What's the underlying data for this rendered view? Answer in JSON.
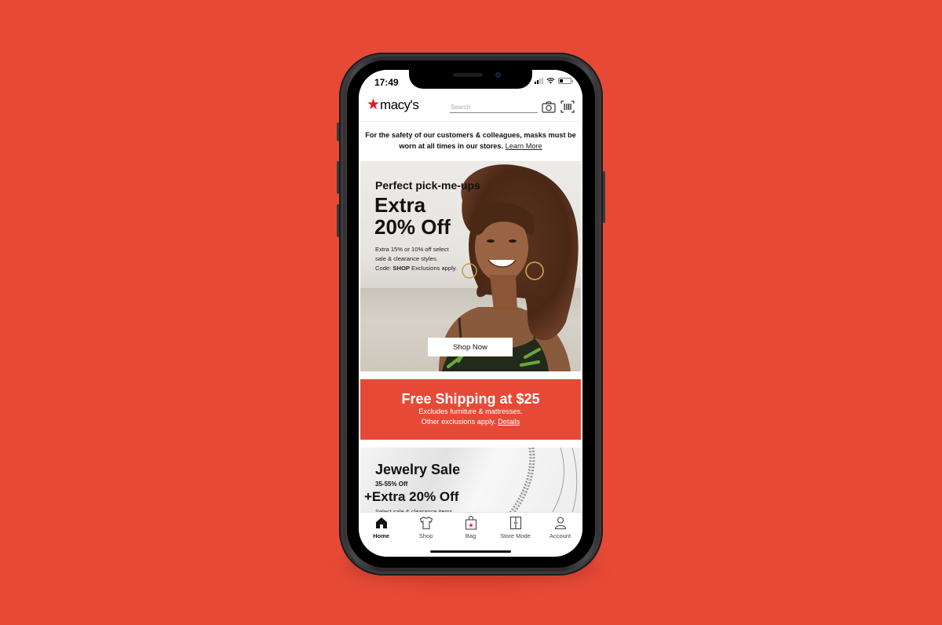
{
  "colors": {
    "background": "#e64a37",
    "brand_red": "#e11b22",
    "promo_banner": "#e64a37"
  },
  "status_bar": {
    "time": "17:49",
    "icons": [
      "signal-icon",
      "wifi-icon",
      "battery-icon"
    ]
  },
  "header": {
    "logo_text": "macy's",
    "search_placeholder": "Search",
    "icons": [
      "search-icon",
      "camera-icon",
      "barcode-scanner-icon"
    ]
  },
  "notice": {
    "text": "For the safety of our customers & colleagues, masks must be worn at all times in our stores.",
    "link": "Learn More"
  },
  "hero": {
    "kicker": "Perfect pick-me-ups",
    "headline_line1": "Extra",
    "headline_line2": "20% Off",
    "sub_line1": "Extra 15% or 10% off select",
    "sub_line2": "sale & clearance styles.",
    "code_label": "Code:",
    "code": "SHOP",
    "exclusions": "Exclusions apply.",
    "cta": "Shop Now"
  },
  "shipping": {
    "title": "Free Shipping at $25",
    "line1": "Excludes furniture & mattresses.",
    "line2": "Other exclusions apply.",
    "link": "Details"
  },
  "jewelry": {
    "title": "Jewelry Sale",
    "range": "35-55% Off",
    "extra": "+Extra 20% Off",
    "note": "Select sale & clearance items"
  },
  "tabbar": {
    "items": [
      {
        "label": "Home",
        "icon": "home-icon",
        "active": true
      },
      {
        "label": "Shop",
        "icon": "shirt-icon",
        "active": false
      },
      {
        "label": "Bag",
        "icon": "bag-icon",
        "active": false
      },
      {
        "label": "Store Mode",
        "icon": "store-mode-icon",
        "active": false
      },
      {
        "label": "Account",
        "icon": "account-icon",
        "active": false
      }
    ]
  }
}
